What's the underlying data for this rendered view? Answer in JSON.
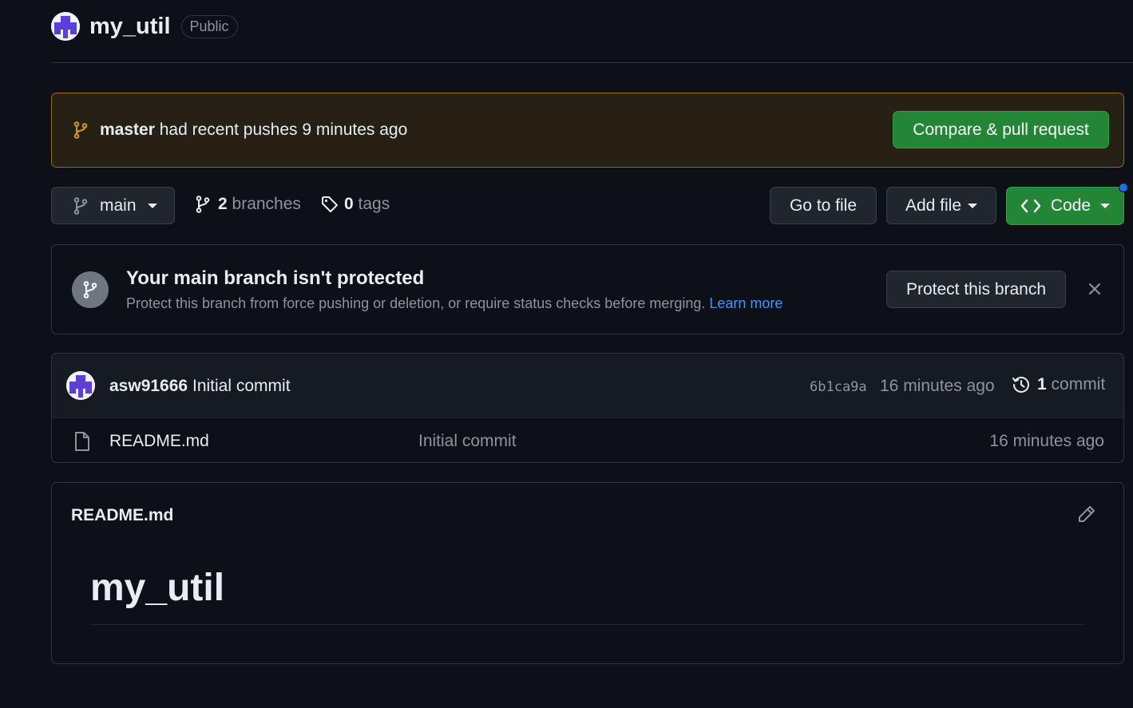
{
  "repo": {
    "name": "my_util",
    "visibility": "Public"
  },
  "push_banner": {
    "branch": "master",
    "message": "had recent pushes 9 minutes ago",
    "button_label": "Compare & pull request"
  },
  "toolbar": {
    "current_branch": "main",
    "branches_count": "2",
    "branches_label": "branches",
    "tags_count": "0",
    "tags_label": "tags",
    "goto_file_label": "Go to file",
    "add_file_label": "Add file",
    "code_label": "Code"
  },
  "protect_notice": {
    "title": "Your main branch isn't protected",
    "description": "Protect this branch from force pushing or deletion, or require status checks before merging.",
    "learn_more": "Learn more",
    "button_label": "Protect this branch"
  },
  "latest_commit": {
    "author": "asw91666",
    "message": "Initial commit",
    "sha": "6b1ca9a",
    "time": "16 minutes ago",
    "count": "1",
    "count_label": "commit"
  },
  "files": [
    {
      "name": "README.md",
      "commit_message": "Initial commit",
      "time": "16 minutes ago",
      "icon": "file-icon"
    }
  ],
  "readme": {
    "title": "README.md",
    "heading": "my_util"
  },
  "colors": {
    "background": "#0d1117",
    "accent_green": "#238636",
    "banner_border": "#9e6a03",
    "link_blue": "#4493f8"
  }
}
